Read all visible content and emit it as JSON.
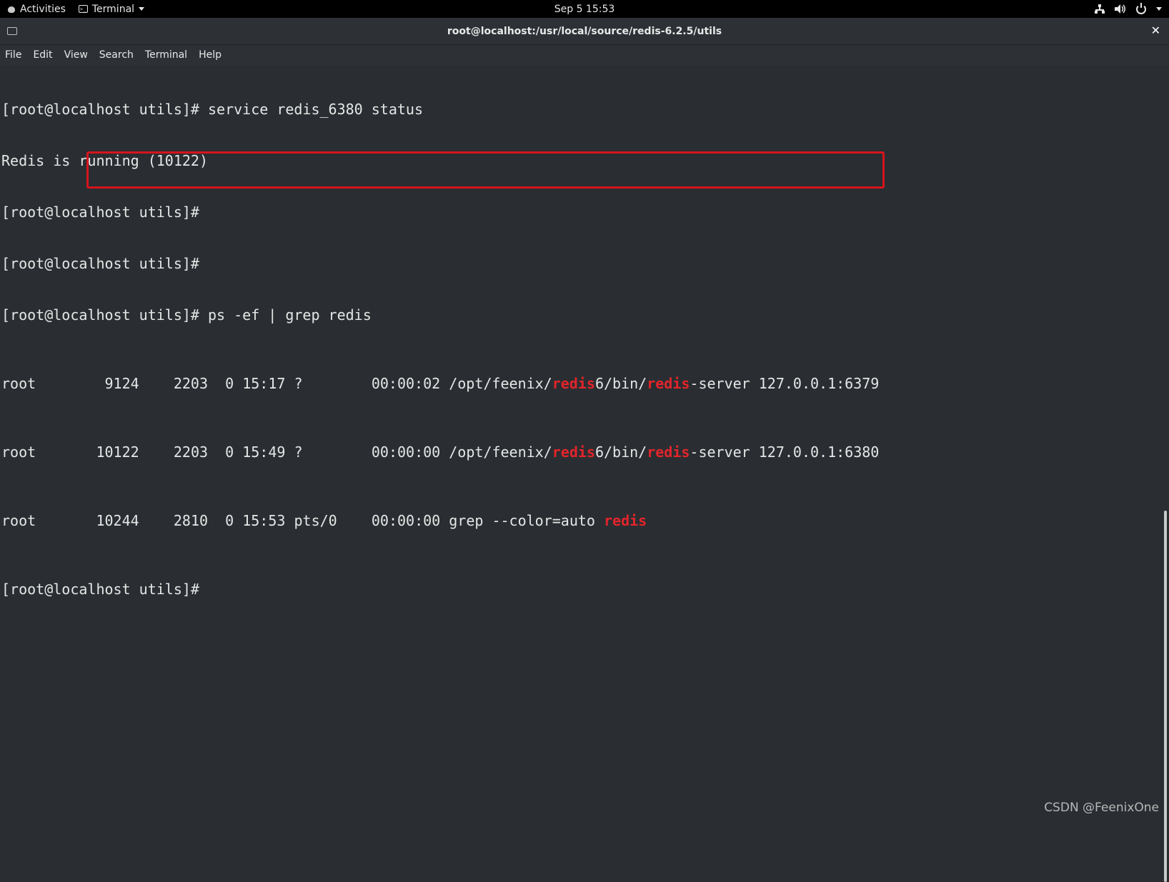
{
  "topbar": {
    "activities": "Activities",
    "app_name": "Terminal",
    "clock": "Sep 5  15:53"
  },
  "window": {
    "title": "root@localhost:/usr/local/source/redis-6.2.5/utils",
    "close_glyph": "✕"
  },
  "menu": [
    "File",
    "Edit",
    "View",
    "Search",
    "Terminal",
    "Help"
  ],
  "terminal": {
    "lines": [
      "[root@localhost utils]# service redis_6380 status",
      "Redis is running (10122)",
      "[root@localhost utils]#",
      "[root@localhost utils]#",
      "[root@localhost utils]# ps -ef | grep redis"
    ],
    "ps_rows": [
      {
        "user": "root",
        "pid": "9124",
        "ppid": "2203",
        "c": "0",
        "stime": "15:17",
        "tty": "?",
        "time": "00:00:02",
        "cmd_pre": "/opt/feenix/",
        "hl1": "redis",
        "cmd_mid": "6/bin/",
        "hl2": "redis",
        "cmd_post": "-server 127.0.0.1:6379"
      },
      {
        "user": "root",
        "pid": "10122",
        "ppid": "2203",
        "c": "0",
        "stime": "15:49",
        "tty": "?",
        "time": "00:00:00",
        "cmd_pre": "/opt/feenix/",
        "hl1": "redis",
        "cmd_mid": "6/bin/",
        "hl2": "redis",
        "cmd_post": "-server 127.0.0.1:6380"
      },
      {
        "user": "root",
        "pid": "10244",
        "ppid": "2810",
        "c": "0",
        "stime": "15:53",
        "tty": "pts/0",
        "time": "00:00:00",
        "cmd_pre": "grep --color=auto ",
        "hl1": "redis",
        "cmd_mid": "",
        "hl2": "",
        "cmd_post": ""
      }
    ],
    "final_prompt": "[root@localhost utils]#"
  },
  "watermark": "CSDN @FeenixOne",
  "colors": {
    "highlight_text": "#e3242b",
    "box_border": "#d7141c",
    "terminal_bg": "#2a2e32"
  }
}
